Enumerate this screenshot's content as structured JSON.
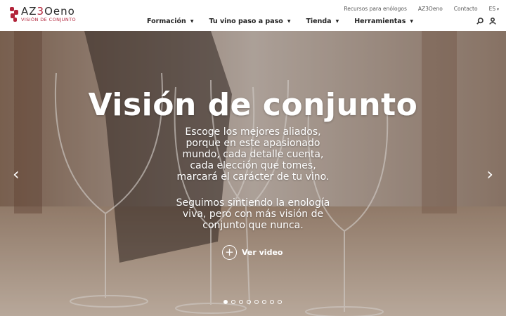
{
  "brand": {
    "name_part1": "AZ",
    "name_part2": "3",
    "name_part3": "Oeno",
    "tagline": "VISIÓN DE CONJUNTO",
    "accent_color": "#b2243a"
  },
  "topbar": {
    "links": [
      "Recursos para enólogos",
      "AZ3Oeno",
      "Contacto"
    ],
    "language": "ES"
  },
  "nav": {
    "items": [
      {
        "label": "Formación"
      },
      {
        "label": "Tu vino paso a paso"
      },
      {
        "label": "Tienda"
      },
      {
        "label": "Herramientas"
      }
    ]
  },
  "tools": {
    "search_icon": "search-icon",
    "user_icon": "user-icon"
  },
  "hero": {
    "title": "Visión de conjunto",
    "paragraph1": [
      "Escoge los mejores aliados,",
      "porque en este apasionado",
      "mundo, cada detalle cuenta,",
      "cada elección que tomes,",
      "marcará el carácter de tu vino."
    ],
    "paragraph2": [
      "Seguimos sintiendo la enología",
      "viva, pero con más visión de",
      "conjunto que nunca."
    ],
    "video_label": "Ver video",
    "prev_glyph": "‹",
    "next_glyph": "›",
    "slide_count": 8,
    "active_slide": 1
  }
}
